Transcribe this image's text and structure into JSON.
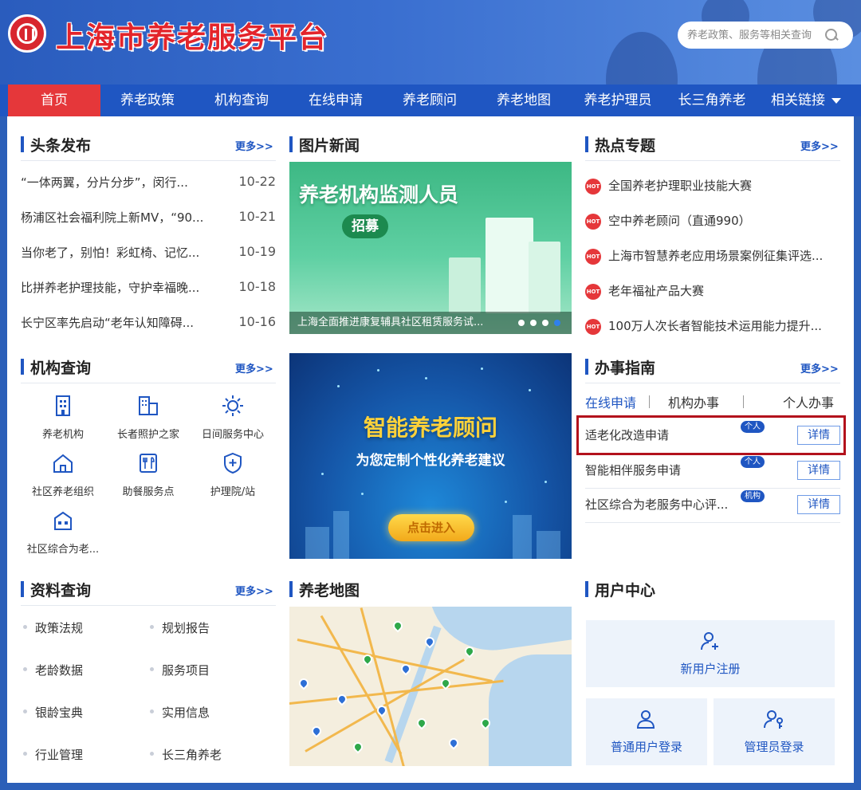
{
  "header": {
    "site_title": "上海市养老服务平台",
    "search_placeholder": "养老政策、服务等相关查询"
  },
  "nav": {
    "items": [
      "首页",
      "养老政策",
      "机构查询",
      "在线申请",
      "养老顾问",
      "养老地图",
      "养老护理员",
      "长三角养老",
      "相关链接"
    ]
  },
  "headlines": {
    "title": "头条发布",
    "more": "更多>>",
    "items": [
      {
        "text": "“一体两翼，分片分步”，闵行...",
        "date": "10-22"
      },
      {
        "text": "杨浦区社会福利院上新MV，“90...",
        "date": "10-21"
      },
      {
        "text": "当你老了，别怕！彩虹椅、记忆...",
        "date": "10-19"
      },
      {
        "text": "比拼养老护理技能，守护幸福晚...",
        "date": "10-18"
      },
      {
        "text": "长宁区率先启动“老年认知障碍...",
        "date": "10-16"
      }
    ]
  },
  "picture_news": {
    "title": "图片新闻",
    "headline": "养老机构监测人员",
    "badge": "招募",
    "caption": "上海全面推进康复辅具社区租赁服务试..."
  },
  "hot_topics": {
    "title": "热点专题",
    "more": "更多>>",
    "hot_label": "HOT",
    "items": [
      "全国养老护理职业技能大赛",
      "空中养老顾问（直通990）",
      "上海市智慧养老应用场景案例征集评选...",
      "老年福祉产品大赛",
      "100万人次长者智能技术运用能力提升..."
    ]
  },
  "institutions": {
    "title": "机构查询",
    "more": "更多>>",
    "items": [
      "养老机构",
      "长者照护之家",
      "日间服务中心",
      "社区养老组织",
      "助餐服务点",
      "护理院/站",
      "社区综合为老..."
    ]
  },
  "advisor": {
    "title": "智能养老顾问",
    "subtitle": "为您定制个性化养老建议",
    "button": "点击进入"
  },
  "guide": {
    "title": "办事指南",
    "more": "更多>>",
    "tabs": [
      "在线申请",
      "机构办事",
      "个人办事"
    ],
    "items": [
      {
        "text": "适老化改造申请",
        "tag": "个人",
        "action": "详情"
      },
      {
        "text": "智能相伴服务申请",
        "tag": "个人",
        "action": "详情"
      },
      {
        "text": "社区综合为老服务中心评...",
        "tag": "机构",
        "action": "详情"
      }
    ]
  },
  "data_lookup": {
    "title": "资料查询",
    "more": "更多>>",
    "items": [
      "政策法规",
      "规划报告",
      "老龄数据",
      "服务项目",
      "银龄宝典",
      "实用信息",
      "行业管理",
      "长三角养老"
    ]
  },
  "map": {
    "title": "养老地图"
  },
  "user_center": {
    "title": "用户中心",
    "register": "新用户注册",
    "user_login": "普通用户登录",
    "admin_login": "管理员登录"
  },
  "colors": {
    "primary": "#1f56c2",
    "accent_red": "#e5373a",
    "highlight": "#b3121c"
  }
}
